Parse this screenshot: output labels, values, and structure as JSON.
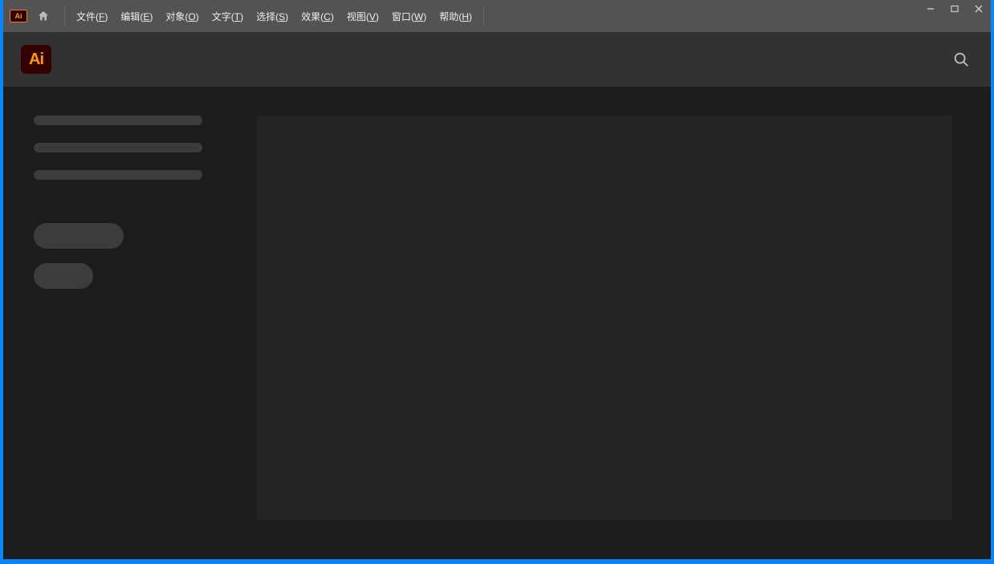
{
  "app": {
    "short_name": "Ai"
  },
  "menubar": {
    "items": [
      {
        "label": "文件",
        "key": "F"
      },
      {
        "label": "编辑",
        "key": "E"
      },
      {
        "label": "对象",
        "key": "O"
      },
      {
        "label": "文字",
        "key": "T"
      },
      {
        "label": "选择",
        "key": "S"
      },
      {
        "label": "效果",
        "key": "C"
      },
      {
        "label": "视图",
        "key": "V"
      },
      {
        "label": "窗口",
        "key": "W"
      },
      {
        "label": "帮助",
        "key": "H"
      }
    ]
  },
  "window_controls": {
    "minimize": "—",
    "maximize": "▭",
    "close": "✕"
  }
}
